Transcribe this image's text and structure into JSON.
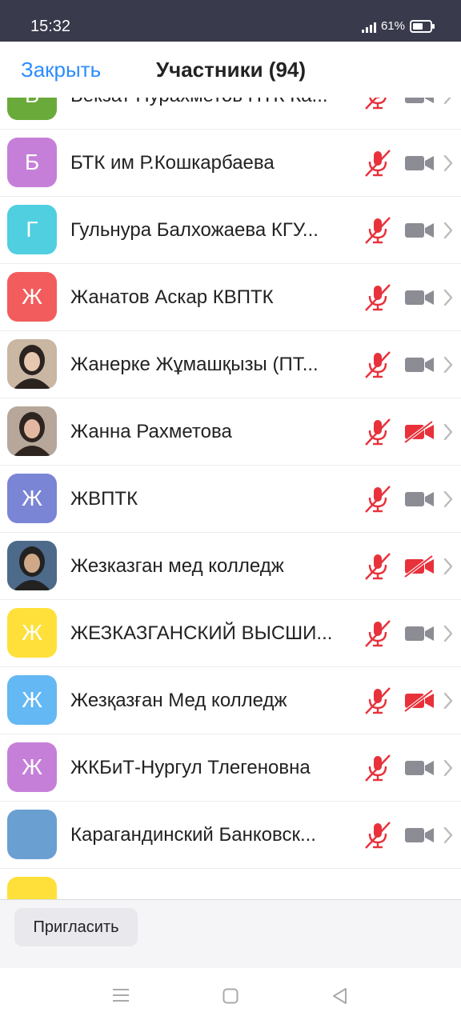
{
  "status_bar": {
    "time": "15:32",
    "battery": "61%"
  },
  "header": {
    "close_label": "Закрыть",
    "title": "Участники (94)"
  },
  "participants": [
    {
      "initial": "Б",
      "name": "Бекзат Нурахметов ПТК Ка...",
      "color": "#6aaa3a",
      "photo": false,
      "mic": "muted",
      "video": "off"
    },
    {
      "initial": "Б",
      "name": "БТК им Р.Кошкарбаева",
      "color": "#c67fd8",
      "photo": false,
      "mic": "muted",
      "video": "off"
    },
    {
      "initial": "Г",
      "name": "Гульнура Балхожаева КГУ...",
      "color": "#4fcfe0",
      "photo": false,
      "mic": "muted",
      "video": "off"
    },
    {
      "initial": "Ж",
      "name": "Жанатов Аскар КВПТК",
      "color": "#f25c5c",
      "photo": false,
      "mic": "muted",
      "video": "off"
    },
    {
      "initial": "",
      "name": "Жанерке Жұмашқызы (ПТ...",
      "color": "",
      "photo": true,
      "mic": "muted",
      "video": "off"
    },
    {
      "initial": "",
      "name": "Жанна Рахметова",
      "color": "",
      "photo": true,
      "mic": "muted",
      "video": "disabled"
    },
    {
      "initial": "Ж",
      "name": "ЖВПТК",
      "color": "#7b85d6",
      "photo": false,
      "mic": "muted",
      "video": "off"
    },
    {
      "initial": "",
      "name": "Жезказган мед колледж",
      "color": "",
      "photo": true,
      "mic": "muted",
      "video": "disabled"
    },
    {
      "initial": "Ж",
      "name": "ЖЕЗКАЗГАНСКИЙ ВЫСШИ...",
      "color": "#ffe03a",
      "photo": false,
      "mic": "muted",
      "video": "off"
    },
    {
      "initial": "Ж",
      "name": "Жезқазған Мед колледж",
      "color": "#64b8f4",
      "photo": false,
      "mic": "muted",
      "video": "disabled"
    },
    {
      "initial": "Ж",
      "name": "ЖКБиТ-Нургул Тлегеновна",
      "color": "#c67fd8",
      "photo": false,
      "mic": "muted",
      "video": "off"
    },
    {
      "initial": "",
      "name": "Карагандинский Банковск...",
      "color": "#6a9fd1",
      "photo": false,
      "mic": "muted",
      "video": "off"
    },
    {
      "initial": "",
      "name": "",
      "color": "#ffe03a",
      "photo": false,
      "mic": "",
      "video": ""
    }
  ],
  "footer": {
    "invite_label": "Пригласить"
  },
  "colors": {
    "accent": "#2d8cff",
    "muted_red": "#e8313b",
    "video_gray": "#8c8c94"
  }
}
